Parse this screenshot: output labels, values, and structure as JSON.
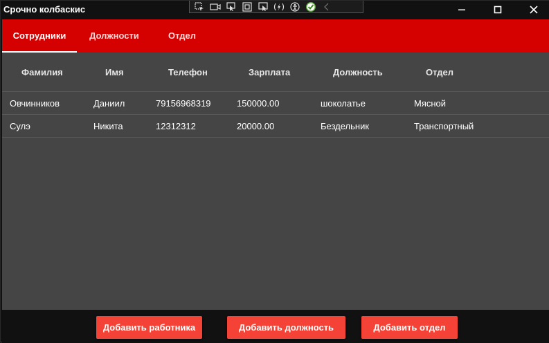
{
  "window": {
    "title": "Срочно колбаскис"
  },
  "toolbar_icons": [
    "select-element-icon",
    "camera-icon",
    "pointer-icon",
    "square-icon",
    "preview-icon",
    "hot-reload-icon",
    "accessibility-icon",
    "check-icon",
    "collapse-arrow-icon"
  ],
  "tabs": [
    {
      "label": "Сотрудники",
      "active": true
    },
    {
      "label": "Должности",
      "active": false
    },
    {
      "label": "Отдел",
      "active": false
    }
  ],
  "table": {
    "columns": [
      "Фамилия",
      "Имя",
      "Телефон",
      "Зарплата",
      "Должность",
      "Отдел"
    ],
    "rows": [
      [
        "Овчинников",
        "Даниил",
        "79156968319",
        "150000.00",
        "шоколатье",
        "Мясной"
      ],
      [
        "Сулэ",
        "Никита",
        "12312312",
        "20000.00",
        "Бездельник",
        "Транспортный"
      ]
    ]
  },
  "buttons": {
    "add_worker": "Добавить работника",
    "add_position": "Добавить должность",
    "add_department": "Добавить отдел"
  },
  "colors": {
    "accent": "#d50000",
    "button": "#f44336",
    "surface": "#454545",
    "chrome": "#111111"
  }
}
